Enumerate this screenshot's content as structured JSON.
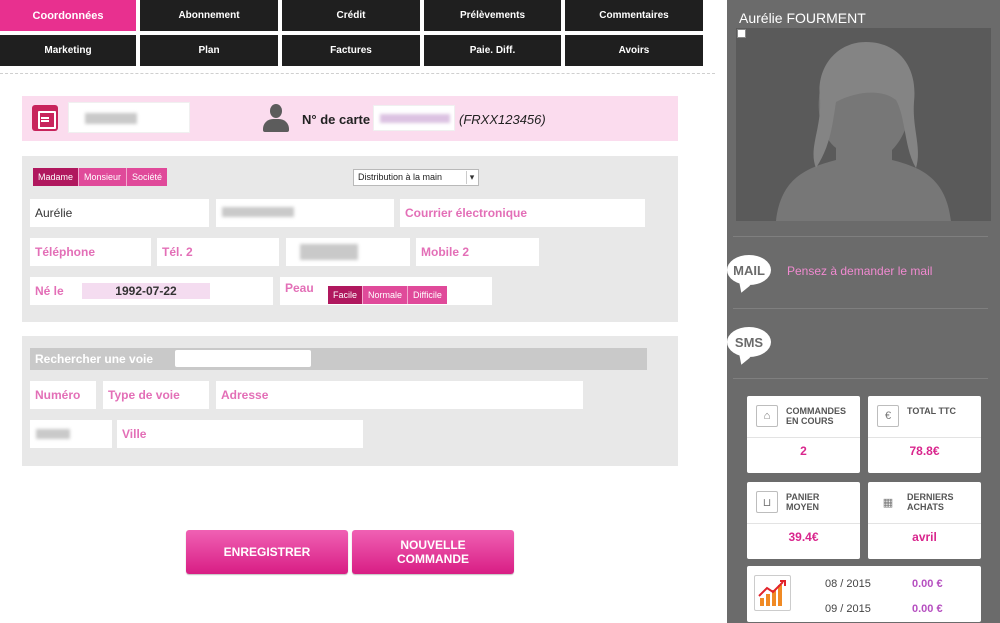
{
  "tabs": {
    "row1": [
      "Coordonnées",
      "Abonnement",
      "Crédit",
      "Prélèvements",
      "Commentaires"
    ],
    "row2": [
      "Marketing",
      "Plan",
      "Factures",
      "Paie. Diff.",
      "Avoirs"
    ]
  },
  "card": {
    "label": "N° de carte",
    "hint": "(FRXX123456)"
  },
  "civility": {
    "options": [
      "Madame",
      "Monsieur",
      "Société"
    ]
  },
  "distribution": {
    "selected": "Distribution à la main"
  },
  "identity": {
    "first_name": "Aurélie",
    "email_placeholder": "Courrier électronique",
    "phone_placeholder": "Téléphone",
    "phone2_placeholder": "Tél. 2",
    "mobile2_placeholder": "Mobile 2",
    "dob_label": "Né le",
    "dob_value": "1992-07-22",
    "skin_label": "Peau",
    "skin_options": [
      "Facile",
      "Normale",
      "Difficile"
    ]
  },
  "address": {
    "search_label": "Rechercher une voie",
    "number_placeholder": "Numéro",
    "street_type_placeholder": "Type de voie",
    "address_placeholder": "Adresse",
    "city_placeholder": "Ville"
  },
  "actions": {
    "save": "ENREGISTRER",
    "new_order_line1": "NOUVELLE",
    "new_order_line2": "COMMANDE"
  },
  "sidebar": {
    "customer_name": "Aurélie FOURMENT",
    "mail_bubble": "MAIL",
    "mail_hint": "Pensez à demander le mail",
    "sms_bubble": "SMS",
    "stats": {
      "orders_label_1": "COMMANDES",
      "orders_label_2": "EN COURS",
      "orders_value": "2",
      "total_label": "TOTAL TTC",
      "total_value": "78.8€",
      "basket_label_1": "PANIER",
      "basket_label_2": "MOYEN",
      "basket_value": "39.4€",
      "last_label_1": "DERNIERS",
      "last_label_2": "ACHATS",
      "last_value": "avril"
    },
    "monthly": [
      {
        "month": "08 / 2015",
        "amount": "0.00 €"
      },
      {
        "month": "09 / 2015",
        "amount": "0.00 €"
      }
    ],
    "colors": {
      "accent": "#e8308f",
      "sidebar_bg": "#6b6b6b",
      "value_pink": "#d9268d"
    }
  }
}
